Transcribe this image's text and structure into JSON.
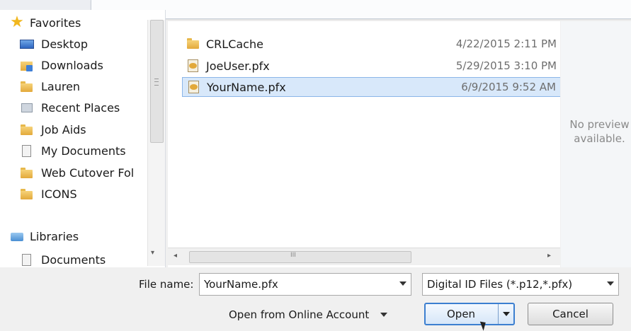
{
  "navigation": {
    "favorites": "Favorites",
    "items": [
      "Desktop",
      "Downloads",
      "Lauren",
      "Recent Places",
      "Job Aids",
      "My Documents",
      "Web Cutover Fol",
      "ICONS"
    ],
    "libraries": "Libraries",
    "documents": "Documents"
  },
  "files": [
    {
      "name": "CRLCache",
      "date": "4/22/2015 2:11 PM",
      "type": "folder"
    },
    {
      "name": "JoeUser.pfx",
      "date": "5/29/2015 3:10 PM",
      "type": "pfx"
    },
    {
      "name": "YourName.pfx",
      "date": "6/9/2015 9:52 AM",
      "type": "pfx",
      "selected": true
    }
  ],
  "preview": {
    "text": "No preview\navailable."
  },
  "bottom": {
    "file_name_label": "File name:",
    "file_name_value": "YourName.pfx",
    "file_type_value": "Digital ID Files (*.p12,*.pfx)",
    "online_account": "Open from Online Account",
    "open_label": "Open",
    "cancel_label": "Cancel"
  },
  "scrollbar": {
    "grip": "III"
  }
}
